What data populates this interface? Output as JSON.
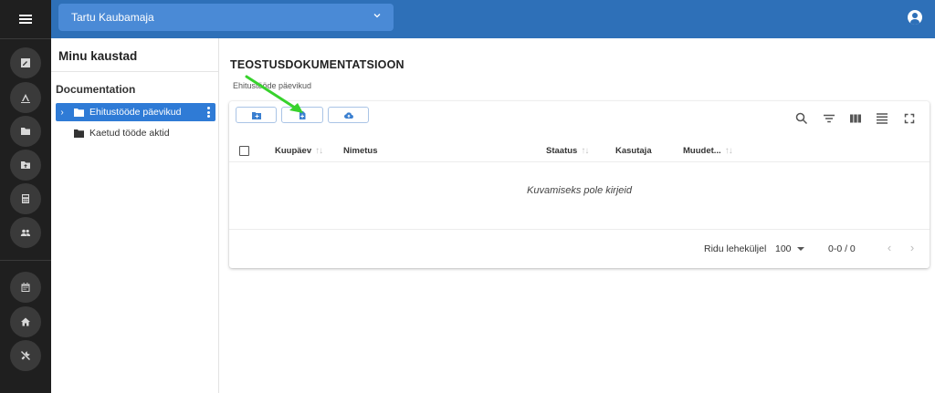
{
  "topbar": {
    "workspace_name": "Tartu Kaubamaja",
    "icons": {
      "menu": "hamburger-icon",
      "dropdown": "chevron-down-icon",
      "user": "account-circle-icon"
    },
    "accent_color": "#2e70b8"
  },
  "rail": {
    "icons": [
      "edit-note-icon",
      "signature-icon",
      "folder-icon",
      "folder-upload-icon",
      "calculator-icon",
      "people-icon",
      "calendar-icon",
      "home-icon",
      "tools-icon"
    ],
    "background": "#1f1f1f"
  },
  "folders": {
    "title": "Minu kaustad",
    "group_label": "Documentation",
    "items": [
      {
        "label": "Ehitustööde päevikud",
        "active": true,
        "icon": "folder-icon"
      },
      {
        "label": "Kaetud tööde aktid",
        "active": false,
        "icon": "folder-icon"
      }
    ],
    "selected_color": "#2f7bd6"
  },
  "main": {
    "title": "TEOSTUSDOKUMENTATSIOON",
    "breadcrumb": "Ehitustööde päevikud",
    "toolbar_buttons": [
      "new-folder-icon",
      "add-file-icon",
      "cloud-upload-icon"
    ],
    "table_tools": [
      "search-icon",
      "filter-icon",
      "columns-icon",
      "density-icon",
      "fullscreen-icon"
    ],
    "columns": [
      "Kuupäev",
      "Nimetus",
      "Staatus",
      "Kasutaja",
      "Muudet..."
    ],
    "empty_message": "Kuvamiseks pole kirjeid",
    "footer": {
      "rows_per_page_label": "Ridu leheküljel",
      "rows_per_page_value": "100",
      "range": "0-0 / 0"
    },
    "annotation_color": "#37d22c"
  }
}
